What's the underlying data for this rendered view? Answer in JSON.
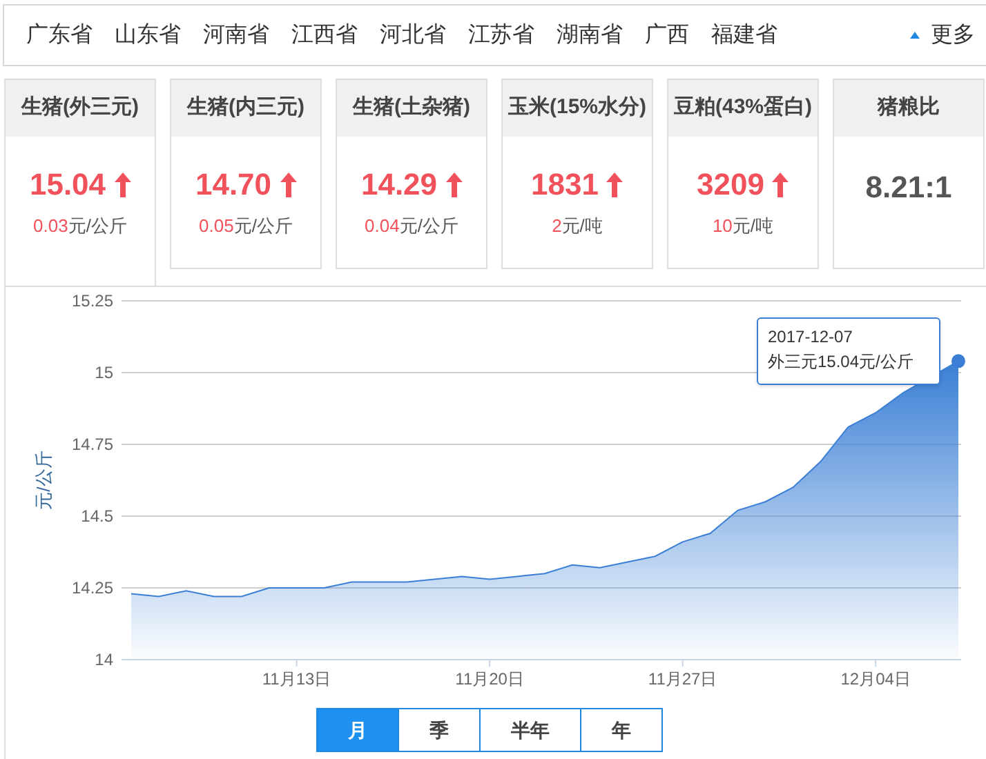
{
  "provinces": {
    "items": [
      "广东省",
      "山东省",
      "河南省",
      "江西省",
      "河北省",
      "江苏省",
      "湖南省",
      "广西",
      "福建省"
    ],
    "more": "更多"
  },
  "cards": [
    {
      "kind": "price",
      "title": "生猪(外三元)",
      "value": "15.04",
      "change": "0.03",
      "unit": "元/公斤",
      "selected": true
    },
    {
      "kind": "price",
      "title": "生猪(内三元)",
      "value": "14.70",
      "change": "0.05",
      "unit": "元/公斤",
      "selected": false
    },
    {
      "kind": "price",
      "title": "生猪(土杂猪)",
      "value": "14.29",
      "change": "0.04",
      "unit": "元/公斤",
      "selected": false
    },
    {
      "kind": "price",
      "title": "玉米(15%水分)",
      "value": "1831",
      "change": "2",
      "unit": "元/吨",
      "selected": false
    },
    {
      "kind": "price",
      "title": "豆粕(43%蛋白)",
      "value": "3209",
      "change": "10",
      "unit": "元/吨",
      "selected": false
    },
    {
      "kind": "ratio",
      "title": "猪粮比",
      "value": "8.21:1",
      "selected": false
    }
  ],
  "chart": {
    "tooltip": {
      "date": "2017-12-07",
      "value": "15.04元/公斤"
    },
    "chart_data": {
      "type": "area",
      "ylabel": "元/公斤",
      "ylim": [
        14,
        15.25
      ],
      "yticks": [
        14,
        14.25,
        14.5,
        14.75,
        15,
        15.25
      ],
      "grid": true,
      "categories": [
        null,
        null,
        null,
        null,
        null,
        null,
        "11月13日",
        null,
        null,
        null,
        null,
        null,
        null,
        "11月20日",
        null,
        null,
        null,
        null,
        null,
        null,
        "11月27日",
        null,
        null,
        null,
        null,
        null,
        null,
        "12月04日",
        null,
        null,
        null
      ],
      "series": [
        {
          "name": "外三元",
          "color": "#3a7fd5",
          "values": [
            14.23,
            14.22,
            14.24,
            14.22,
            14.22,
            14.25,
            14.25,
            14.25,
            14.27,
            14.27,
            14.27,
            14.28,
            14.29,
            14.28,
            14.29,
            14.3,
            14.33,
            14.32,
            14.34,
            14.36,
            14.41,
            14.44,
            14.52,
            14.55,
            14.6,
            14.69,
            14.81,
            14.86,
            14.93,
            null,
            15.04
          ]
        }
      ]
    }
  },
  "ranges": [
    {
      "label": "月",
      "selected": true
    },
    {
      "label": "季",
      "selected": false
    },
    {
      "label": "半年",
      "selected": false
    },
    {
      "label": "年",
      "selected": false
    }
  ]
}
